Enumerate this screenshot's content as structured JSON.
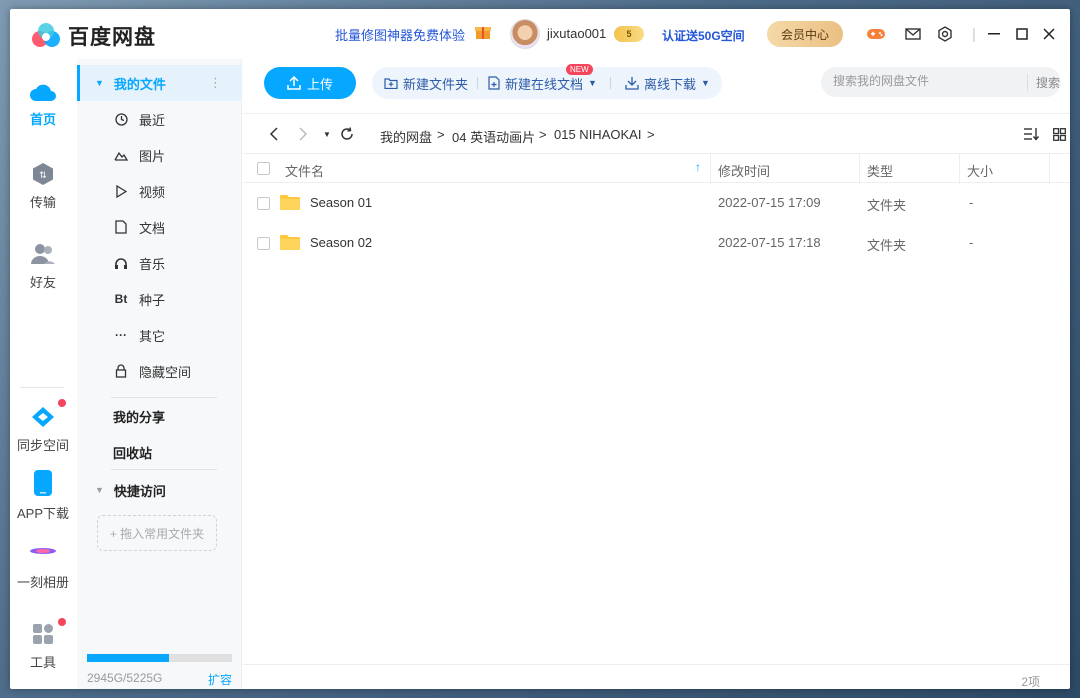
{
  "app": {
    "name": "百度网盘",
    "promo": "批量修图神器免费体验",
    "username": "jixutao001",
    "level": "5",
    "verify": "认证送50G空间",
    "vip": "会员中心"
  },
  "rail": [
    {
      "label": "首页",
      "icon": "cloud-icon",
      "active": true
    },
    {
      "label": "传输",
      "icon": "transfer-icon"
    },
    {
      "label": "好友",
      "icon": "friends-icon"
    },
    {
      "label": "同步空间",
      "icon": "sync-icon",
      "dot": true
    },
    {
      "label": "APP下载",
      "icon": "phone-icon"
    },
    {
      "label": "一刻相册",
      "icon": "album-icon"
    },
    {
      "label": "工具",
      "icon": "tools-icon",
      "dot": true
    }
  ],
  "sidebar": {
    "my_files": "我的文件",
    "items": [
      {
        "label": "最近",
        "icon": "clock-icon"
      },
      {
        "label": "图片",
        "icon": "image-icon"
      },
      {
        "label": "视频",
        "icon": "play-icon"
      },
      {
        "label": "文档",
        "icon": "document-icon"
      },
      {
        "label": "音乐",
        "icon": "headphones-icon"
      },
      {
        "label": "种子",
        "icon": "bt-icon"
      },
      {
        "label": "其它",
        "icon": "more-icon"
      },
      {
        "label": "隐藏空间",
        "icon": "lock-icon"
      }
    ],
    "my_share": "我的分享",
    "recycle": "回收站",
    "quick_access": "快捷访问",
    "drag_hint": "+ 拖入常用文件夹",
    "quota_text": "2945G/5225G",
    "quota_fraction": 0.5636,
    "expand": "扩容"
  },
  "toolbar": {
    "upload": "上传",
    "new_folder": "新建文件夹",
    "new_doc": "新建在线文档",
    "new_badge": "NEW",
    "offline": "离线下载",
    "search_placeholder": "搜索我的网盘文件",
    "search_btn": "搜索"
  },
  "breadcrumb": [
    "我的网盘",
    "04 英语动画片",
    "015 NIHAOKAI"
  ],
  "columns": {
    "name": "文件名",
    "modified": "修改时间",
    "type": "类型",
    "size": "大小"
  },
  "files": [
    {
      "name": "Season 01",
      "modified": "2022-07-15 17:09",
      "type": "文件夹",
      "size": "-"
    },
    {
      "name": "Season 02",
      "modified": "2022-07-15 17:18",
      "type": "文件夹",
      "size": "-"
    }
  ],
  "footer": {
    "count": "2项"
  },
  "colors": {
    "accent": "#06a7ff",
    "link": "#2456d8",
    "badge": "#f5455c"
  }
}
